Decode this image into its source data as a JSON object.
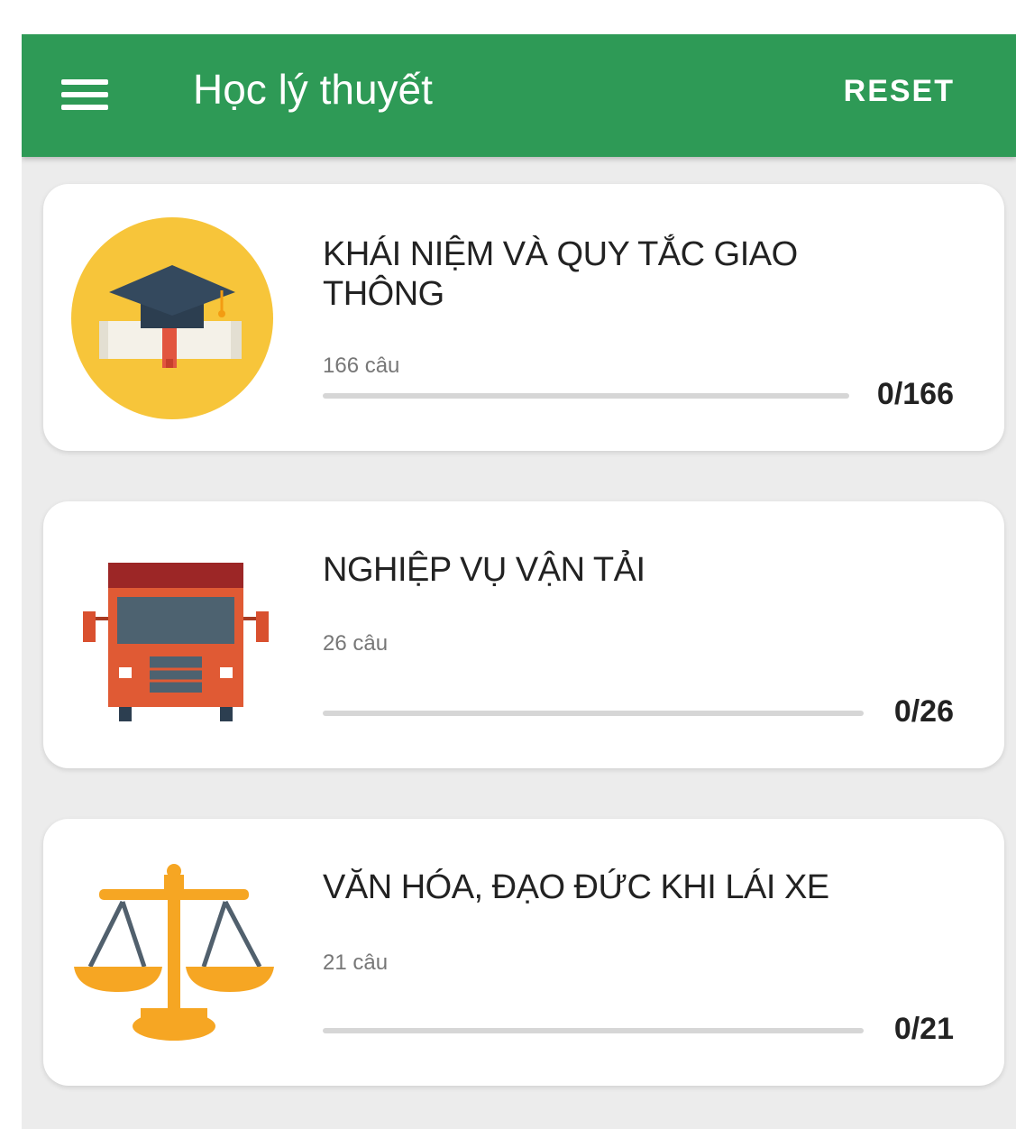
{
  "appbar": {
    "title": "Học lý thuyết",
    "reset_label": "RESET",
    "color": "#2e9a56"
  },
  "topics": [
    {
      "title": "KHÁI NIỆM VÀ QUY TẮC GIAO THÔNG",
      "count_label": "166 câu",
      "progress_label": "0/166",
      "progress": 0,
      "icon": "graduation-cap-icon"
    },
    {
      "title": "NGHIỆP VỤ VẬN TẢI",
      "count_label": "26 câu",
      "progress_label": "0/26",
      "progress": 0,
      "icon": "truck-icon"
    },
    {
      "title": "VĂN HÓA, ĐẠO ĐỨC KHI LÁI XE",
      "count_label": "21 câu",
      "progress_label": "0/21",
      "progress": 0,
      "icon": "scales-icon"
    }
  ]
}
